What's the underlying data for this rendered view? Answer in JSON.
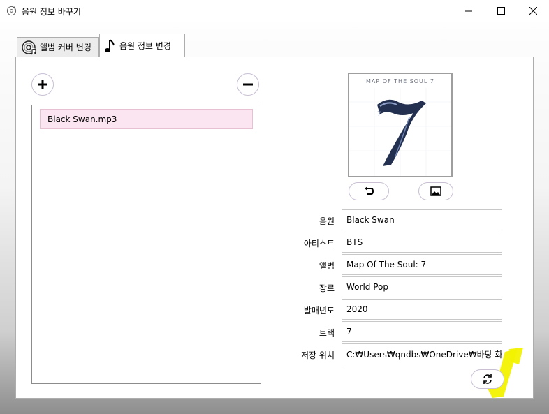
{
  "window": {
    "title": "음원 정보 바꾸기"
  },
  "tabs": [
    {
      "label": "앨범 커버 변경",
      "icon": "album-cd-icon",
      "active": false
    },
    {
      "label": "음원 정보 변경",
      "icon": "music-note-icon",
      "active": true
    }
  ],
  "file_list": {
    "items": [
      "Black Swan.mp3"
    ]
  },
  "cover": {
    "title_text": "MAP OF THE SOUL 7",
    "number": "7"
  },
  "fields": [
    {
      "label": "음원",
      "value": "Black Swan"
    },
    {
      "label": "아티스트",
      "value": "BTS"
    },
    {
      "label": "앨범",
      "value": "Map Of The Soul: 7"
    },
    {
      "label": "장르",
      "value": "World Pop"
    },
    {
      "label": "발매년도",
      "value": "2020"
    },
    {
      "label": "트랙",
      "value": "7"
    },
    {
      "label": "저장 위치",
      "value": "C:₩Users₩qndbs₩OneDrive₩바탕 화면₩"
    }
  ],
  "icons": {
    "add": "plus-icon",
    "remove": "minus-icon",
    "undo": "undo-icon",
    "image": "image-icon",
    "refresh": "refresh-icon"
  },
  "colors": {
    "selected_item_bg": "#fbe5f0",
    "highlight": "#f2f200"
  }
}
